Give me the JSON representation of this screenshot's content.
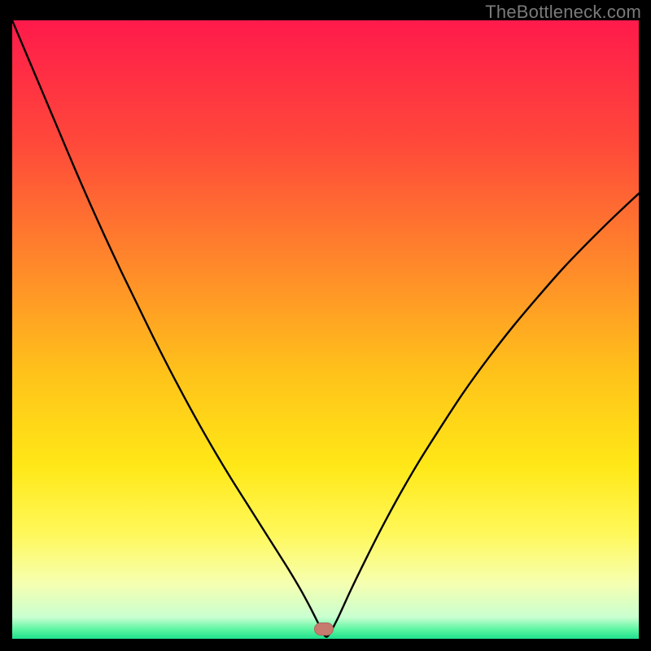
{
  "watermark": "TheBottleneck.com",
  "marker": {
    "x_frac": 0.498,
    "y_frac": 0.984
  },
  "chart_data": {
    "type": "line",
    "title": "",
    "xlabel": "",
    "ylabel": "",
    "xlim": [
      0,
      100
    ],
    "ylim": [
      0,
      100
    ],
    "gradient_stops": [
      {
        "offset": 0.0,
        "color": "#ff1a4b"
      },
      {
        "offset": 0.2,
        "color": "#ff493a"
      },
      {
        "offset": 0.4,
        "color": "#ff8a2a"
      },
      {
        "offset": 0.57,
        "color": "#ffc21a"
      },
      {
        "offset": 0.72,
        "color": "#ffe817"
      },
      {
        "offset": 0.83,
        "color": "#fff85a"
      },
      {
        "offset": 0.91,
        "color": "#f6ffb0"
      },
      {
        "offset": 0.965,
        "color": "#c9ffd0"
      },
      {
        "offset": 0.985,
        "color": "#5cf5a2"
      },
      {
        "offset": 1.0,
        "color": "#1fe08c"
      }
    ],
    "series": [
      {
        "name": "bottleneck-curve",
        "x": [
          0.0,
          2.5,
          5.0,
          7.5,
          10.0,
          12.5,
          15.0,
          17.5,
          20.0,
          22.5,
          25.0,
          27.5,
          30.0,
          32.5,
          35.0,
          37.5,
          40.0,
          42.0,
          44.0,
          46.0,
          47.5,
          48.8,
          49.8,
          50.5,
          52.0,
          54.0,
          56.5,
          59.0,
          62.0,
          65.0,
          68.5,
          72.0,
          76.0,
          80.0,
          84.0,
          88.0,
          92.0,
          96.0,
          100.0
        ],
        "y": [
          100.0,
          94.0,
          88.0,
          82.0,
          76.0,
          70.2,
          64.6,
          59.2,
          54.0,
          48.8,
          43.8,
          39.0,
          34.4,
          30.0,
          25.8,
          21.8,
          17.8,
          14.6,
          11.4,
          8.0,
          5.2,
          2.6,
          0.6,
          0.6,
          3.4,
          7.8,
          13.0,
          18.0,
          23.6,
          28.8,
          34.4,
          39.8,
          45.4,
          50.6,
          55.4,
          60.0,
          64.2,
          68.2,
          72.0
        ]
      }
    ]
  }
}
